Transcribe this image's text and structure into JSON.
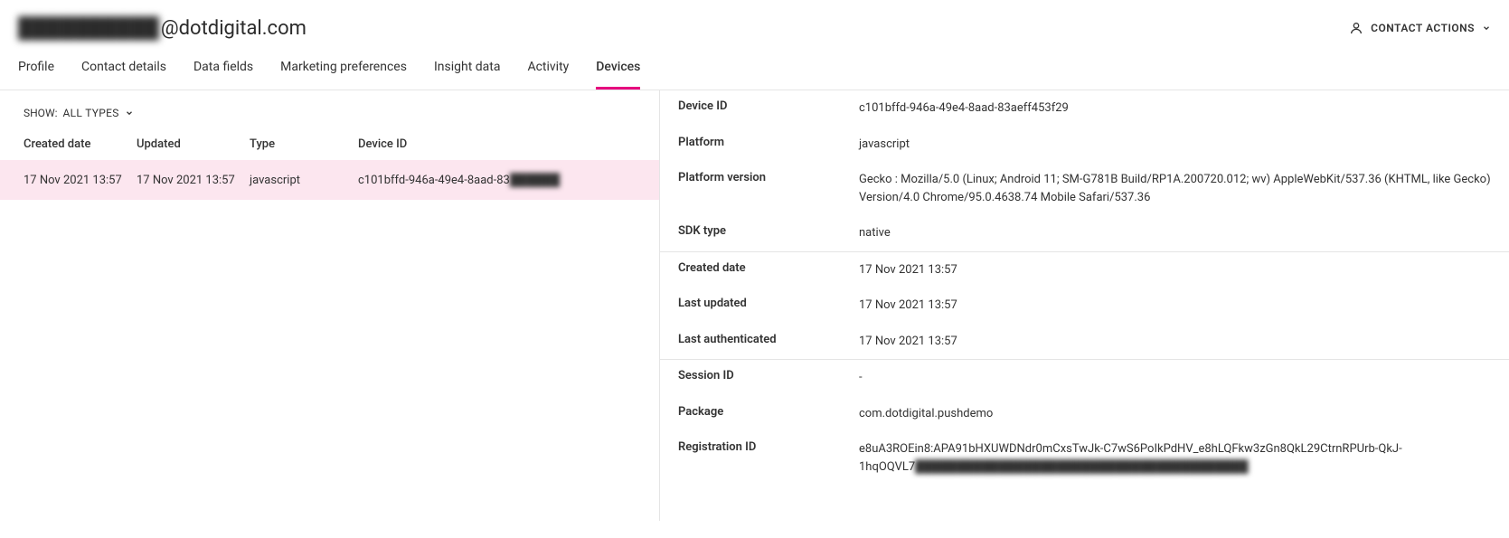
{
  "header": {
    "email_prefix": "██████████",
    "email_suffix": "@dotdigital.com",
    "contact_actions_label": "CONTACT ACTIONS"
  },
  "tabs": [
    {
      "label": "Profile",
      "active": false
    },
    {
      "label": "Contact details",
      "active": false
    },
    {
      "label": "Data fields",
      "active": false
    },
    {
      "label": "Marketing preferences",
      "active": false
    },
    {
      "label": "Insight data",
      "active": false
    },
    {
      "label": "Activity",
      "active": false
    },
    {
      "label": "Devices",
      "active": true
    }
  ],
  "filter": {
    "label": "SHOW:",
    "value": "ALL TYPES"
  },
  "table": {
    "headers": {
      "created": "Created date",
      "updated": "Updated",
      "type": "Type",
      "device_id": "Device ID"
    },
    "rows": [
      {
        "created": "17 Nov 2021 13:57",
        "updated": "17 Nov 2021 13:57",
        "type": "javascript",
        "device_id_visible": "c101bffd-946a-49e4-8aad-83",
        "device_id_blur": "██████"
      }
    ]
  },
  "details": {
    "group1": {
      "device_id": {
        "label": "Device ID",
        "value": "c101bffd-946a-49e4-8aad-83aeff453f29"
      },
      "platform": {
        "label": "Platform",
        "value": "javascript"
      },
      "platform_version": {
        "label": "Platform version",
        "value": "Gecko : Mozilla/5.0 (Linux; Android 11; SM-G781B Build/RP1A.200720.012; wv) AppleWebKit/537.36 (KHTML, like Gecko) Version/4.0 Chrome/95.0.4638.74 Mobile Safari/537.36"
      },
      "sdk_type": {
        "label": "SDK type",
        "value": "native"
      }
    },
    "group2": {
      "created_date": {
        "label": "Created date",
        "value": "17 Nov 2021 13:57"
      },
      "last_updated": {
        "label": "Last updated",
        "value": "17 Nov 2021 13:57"
      },
      "last_authenticated": {
        "label": "Last authenticated",
        "value": "17 Nov 2021 13:57"
      }
    },
    "group3": {
      "session_id": {
        "label": "Session ID",
        "value": "-"
      },
      "package": {
        "label": "Package",
        "value": "com.dotdigital.pushdemo"
      },
      "registration_id": {
        "label": "Registration ID",
        "value_visible": "e8uA3ROEin8:APA91bHXUWDNdr0mCxsTwJk-C7wS6PoIkPdHV_e8hLQFkw3zGn8QkL29CtrnRPUrb-QkJ-1hqOQVL7",
        "value_blur": "████████████████████████████████████████"
      }
    }
  }
}
